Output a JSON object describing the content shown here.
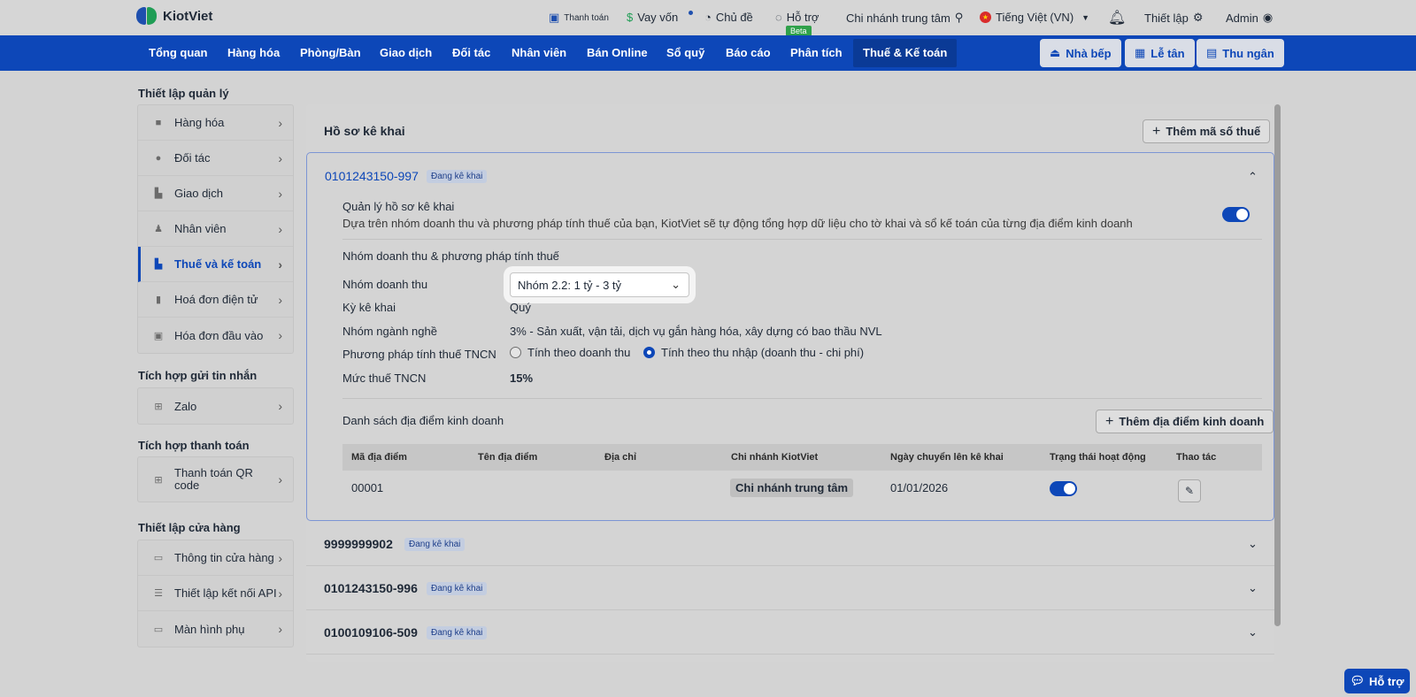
{
  "brand": {
    "name": "KiotViet"
  },
  "top": {
    "payment": "Thanh toán",
    "loan": "Vay vốn",
    "theme": "Chủ đề",
    "support": "Hỗ trợ",
    "beta": "Beta",
    "branch": "Chi nhánh trung tâm",
    "language": "Tiếng Việt (VN)",
    "settings": "Thiết lập",
    "user": "Admin"
  },
  "nav": {
    "items": [
      "Tổng quan",
      "Hàng hóa",
      "Phòng/Bàn",
      "Giao dịch",
      "Đối tác",
      "Nhân viên",
      "Bán Online",
      "Sổ quỹ",
      "Báo cáo",
      "Phân tích",
      "Thuế & Kế toán"
    ],
    "buttons": [
      "Nhà bếp",
      "Lễ tân",
      "Thu ngân"
    ]
  },
  "sidebar": {
    "sections": [
      {
        "title": "Thiết lập quản lý",
        "items": [
          "Hàng hóa",
          "Đối tác",
          "Giao dịch",
          "Nhân viên",
          "Thuế và kế toán",
          "Hoá đơn điện tử",
          "Hóa đơn đầu vào"
        ]
      },
      {
        "title": "Tích hợp gửi tin nhắn",
        "items": [
          "Zalo"
        ]
      },
      {
        "title": "Tích hợp thanh toán",
        "items": [
          "Thanh toán QR code"
        ]
      },
      {
        "title": "Thiết lập cửa hàng",
        "items": [
          "Thông tin cửa hàng",
          "Thiết lập kết nối API",
          "Màn hình phụ"
        ]
      }
    ]
  },
  "main": {
    "title": "Hồ sơ kê khai",
    "add_tax_code": "Thêm mã số thuế",
    "status_badge": "Đang kê khai",
    "profile": {
      "tax_id": "0101243150-997",
      "manage_title": "Quản lý hồ sơ kê khai",
      "manage_desc": "Dựa trên nhóm doanh thu và phương pháp tính thuế của bạn, KiotViet sẽ tự động tổng hợp dữ liệu cho tờ khai và sổ kế toán của từng địa điểm kinh doanh",
      "section_title": "Nhóm doanh thu & phương pháp tính thuế",
      "revenue_group_label": "Nhóm doanh thu",
      "revenue_group_value": "Nhóm 2.2: 1 tỷ - 3 tỷ",
      "period_label": "Kỳ kê khai",
      "period_value": "Quý",
      "industry_label": "Nhóm ngành nghề",
      "industry_value": "3% - Sản xuất, vận tải, dịch vụ gắn hàng hóa, xây dựng có bao thầu NVL",
      "method_label": "Phương pháp tính thuế TNCN",
      "method_option_1": "Tính theo doanh thu",
      "method_option_2": "Tính theo thu nhập (doanh thu - chi phí)",
      "rate_label": "Mức thuế TNCN",
      "rate_value": "15%",
      "locations_title": "Danh sách địa điểm kinh doanh",
      "add_location": "Thêm địa điểm kinh doanh",
      "table": {
        "headers": [
          "Mã địa điểm",
          "Tên địa điểm",
          "Địa chỉ",
          "Chi nhánh KiotViet",
          "Ngày chuyển lên kê khai",
          "Trạng thái hoạt động",
          "Thao tác"
        ],
        "rows": [
          {
            "code": "00001",
            "name": "",
            "address": "",
            "branch": "Chi nhánh trung tâm",
            "date": "01/01/2026"
          }
        ]
      }
    },
    "other_profiles": [
      "9999999902",
      "0101243150-996",
      "0100109106-509"
    ]
  },
  "help_button": "Hỗ trợ",
  "colors": {
    "primary": "#0d47b8",
    "success": "#2fa14a"
  }
}
